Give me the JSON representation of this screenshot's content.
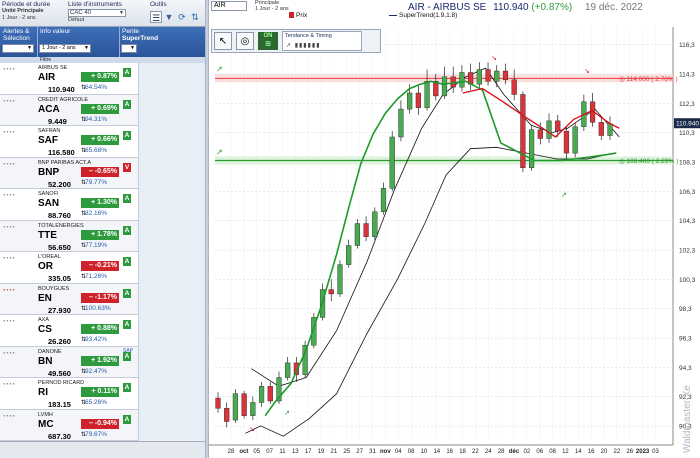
{
  "toolbar": {
    "period_label": "Période et durée",
    "period_sub1": "Unité Principale",
    "period_sub2": "1 Jour - 2 ans",
    "instr_label": "Liste d'instruments",
    "instr_value": "CAC 40",
    "instr_sub": "Défaut",
    "outils_label": "Outils"
  },
  "list_header": {
    "col1": "Alertes & Sélection",
    "col2": "Info valeur",
    "col2_dd": "1 Jour - 2 ans",
    "col3a": "Pente",
    "col3b": "SuperTrend",
    "filtre": "Filtre"
  },
  "rows": [
    {
      "name": "AIRBUS SE",
      "ticker": "AIR",
      "price": "110.940",
      "change": "+ 0.87%",
      "dir": "up",
      "pct2": "64.54%",
      "signal": "A",
      "sap": ""
    },
    {
      "name": "CREDIT AGRICOLE",
      "ticker": "ACA",
      "price": "9.449",
      "change": "+ 0.69%",
      "dir": "up",
      "pct2": "94.31%",
      "signal": "A",
      "sap": ""
    },
    {
      "name": "SAFRAN",
      "ticker": "SAF",
      "price": "116.580",
      "change": "+ 0.66%",
      "dir": "up",
      "pct2": "65.68%",
      "signal": "A",
      "sap": ""
    },
    {
      "name": "BNP PARIBAS ACT.A",
      "ticker": "BNP",
      "price": "52.200",
      "change": "– -0.65%",
      "dir": "dn",
      "pct2": "79.77%",
      "signal": "V",
      "sap": ""
    },
    {
      "name": "SANOFI",
      "ticker": "SAN",
      "price": "88.760",
      "change": "+ 1.30%",
      "dir": "up",
      "pct2": "82.16%",
      "signal": "A",
      "sap": ""
    },
    {
      "name": "TOTALENERGIES",
      "ticker": "TTE",
      "price": "56.650",
      "change": "+ 1.78%",
      "dir": "up",
      "pct2": "77.19%",
      "signal": "A",
      "sap": ""
    },
    {
      "name": "L'OREAL",
      "ticker": "OR",
      "price": "335.05",
      "change": "– -0.21%",
      "dir": "dn",
      "pct2": "71.26%",
      "signal": "A",
      "sap": ""
    },
    {
      "name": "BOUYGUES",
      "ticker": "EN",
      "price": "27.930",
      "change": "– -1.17%",
      "dir": "dn",
      "pct2": "100.63%",
      "signal": "A",
      "sap": ""
    },
    {
      "name": "AXA",
      "ticker": "CS",
      "price": "26.260",
      "change": "+ 0.88%",
      "dir": "up",
      "pct2": "93.42%",
      "signal": "A",
      "sap": ""
    },
    {
      "name": "DANONE",
      "ticker": "BN",
      "price": "49.560",
      "change": "+ 1.92%",
      "dir": "up",
      "pct2": "92.47%",
      "signal": "A",
      "sap": "SAP"
    },
    {
      "name": "PERNOD RICARD",
      "ticker": "RI",
      "price": "183.15",
      "change": "+ 0.11%",
      "dir": "up",
      "pct2": "65.26%",
      "signal": "A",
      "sap": ""
    },
    {
      "name": "LVMH",
      "ticker": "MC",
      "price": "687.30",
      "change": "– -0.94%",
      "dir": "dn",
      "pct2": "79.67%",
      "signal": "A",
      "sap": ""
    }
  ],
  "chart_header": {
    "symbol": "AIR",
    "princ_line1": "Principale",
    "princ_line2": "1 Jour - 2 ans",
    "legend_price": "Prix",
    "legend_st": "SuperTrend(1.9,1.8)",
    "title_name": "AIR - AIRBUS SE",
    "title_price": "110.940",
    "title_change": "(+0.87%)",
    "title_date": "19 déc. 2022",
    "tendance_label": "Tendance & Timing",
    "on_label": "ON"
  },
  "chart_data": {
    "type": "candlestick",
    "ylim": [
      89,
      117.5
    ],
    "yticks": [
      "116,3",
      "114,3",
      "112,3",
      "110,3",
      "108,3",
      "106,3",
      "104,3",
      "102,3",
      "100,3",
      "98,3",
      "96,3",
      "94,3",
      "92,3",
      "90,3"
    ],
    "xticks": [
      "28",
      "oct",
      "05",
      "07",
      "11",
      "13",
      "17",
      "19",
      "21",
      "25",
      "27",
      "31",
      "nov",
      "04",
      "08",
      "10",
      "14",
      "16",
      "18",
      "22",
      "24",
      "28",
      "déc",
      "02",
      "06",
      "08",
      "12",
      "14",
      "16",
      "20",
      "22",
      "26",
      "2023",
      "03"
    ],
    "last_price": "110.940",
    "resistance": {
      "value": 114.0,
      "label": "◎ 114.000 ( 2.76% )",
      "color": "#e83a3a"
    },
    "support": {
      "value": 108.4,
      "label": "◎ 108.400 ( 2.29% )",
      "color": "#2e9a2e"
    },
    "candles": [
      [
        92.2,
        91.5,
        92.6,
        91.2
      ],
      [
        91.5,
        90.6,
        91.9,
        90.2
      ],
      [
        90.7,
        92.5,
        92.8,
        90.5
      ],
      [
        92.5,
        91.0,
        92.7,
        90.8
      ],
      [
        91.0,
        91.9,
        92.3,
        90.7
      ],
      [
        91.9,
        93.0,
        93.3,
        91.6
      ],
      [
        93.0,
        92.0,
        93.3,
        91.8
      ],
      [
        92.0,
        93.6,
        94.0,
        91.8
      ],
      [
        93.6,
        94.6,
        95.0,
        93.4
      ],
      [
        94.6,
        93.8,
        95.0,
        93.3
      ],
      [
        93.8,
        95.8,
        96.1,
        93.6
      ],
      [
        95.8,
        97.7,
        98.0,
        95.6
      ],
      [
        97.7,
        99.6,
        100.0,
        97.5
      ],
      [
        99.6,
        99.3,
        100.3,
        98.8
      ],
      [
        99.3,
        101.3,
        101.6,
        99.1
      ],
      [
        101.3,
        102.6,
        103.0,
        101.1
      ],
      [
        102.6,
        104.1,
        104.4,
        102.4
      ],
      [
        104.1,
        103.2,
        104.6,
        102.9
      ],
      [
        103.2,
        104.9,
        105.2,
        103.0
      ],
      [
        104.9,
        106.5,
        106.9,
        104.7
      ],
      [
        106.5,
        110.0,
        110.4,
        106.3
      ],
      [
        110.0,
        111.9,
        112.5,
        109.7
      ],
      [
        111.9,
        113.0,
        113.6,
        111.6
      ],
      [
        113.0,
        112.0,
        113.6,
        111.5
      ],
      [
        112.0,
        113.8,
        114.6,
        111.8
      ],
      [
        113.8,
        112.8,
        114.3,
        112.5
      ],
      [
        112.8,
        114.1,
        114.8,
        112.6
      ],
      [
        114.1,
        113.4,
        114.8,
        113.0
      ],
      [
        113.4,
        114.4,
        114.9,
        113.1
      ],
      [
        114.4,
        113.6,
        115.0,
        113.2
      ],
      [
        113.6,
        114.6,
        115.1,
        113.3
      ],
      [
        114.6,
        113.8,
        115.1,
        113.5
      ],
      [
        113.8,
        114.5,
        114.9,
        113.4
      ],
      [
        114.5,
        113.9,
        115.0,
        113.6
      ],
      [
        113.9,
        112.9,
        114.6,
        112.5
      ],
      [
        112.9,
        107.9,
        113.1,
        107.6
      ],
      [
        107.9,
        110.5,
        110.8,
        107.7
      ],
      [
        110.5,
        109.9,
        111.0,
        109.5
      ],
      [
        109.9,
        111.1,
        111.6,
        109.6
      ],
      [
        111.1,
        110.4,
        111.5,
        110.0
      ],
      [
        110.4,
        108.9,
        110.7,
        108.5
      ],
      [
        108.9,
        110.7,
        111.0,
        108.6
      ],
      [
        110.7,
        112.4,
        112.9,
        110.4
      ],
      [
        112.4,
        111.0,
        113.0,
        110.7
      ],
      [
        111.0,
        110.1,
        111.4,
        109.8
      ],
      [
        110.1,
        110.9,
        111.4,
        109.8
      ]
    ],
    "supertrend_green": [
      [
        33,
        91.0
      ],
      [
        40,
        92.0
      ],
      [
        50,
        93.2
      ],
      [
        60,
        95.5
      ],
      [
        70,
        98.5
      ],
      [
        80,
        102.0
      ],
      [
        88,
        105.2
      ],
      [
        96,
        108.2
      ],
      [
        104,
        110.2
      ],
      [
        112,
        111.6
      ],
      [
        120,
        112.6
      ],
      [
        128,
        113.3
      ],
      [
        135,
        113.6
      ],
      [
        142,
        113.8
      ],
      [
        150,
        113.6
      ],
      [
        165,
        113.8
      ],
      [
        176,
        113.2
      ],
      [
        188,
        109.6
      ],
      [
        210,
        108.4
      ],
      [
        228,
        108.4
      ],
      [
        244,
        108.6
      ],
      [
        258,
        108.8
      ],
      [
        264,
        108.9
      ]
    ],
    "supertrend_red": [
      [
        163,
        113.0
      ],
      [
        176,
        113.3
      ],
      [
        188,
        112.5
      ],
      [
        205,
        111.3
      ],
      [
        214,
        110.7
      ],
      [
        224,
        110.0
      ],
      [
        236,
        111.2
      ],
      [
        248,
        111.8
      ],
      [
        260,
        110.9
      ],
      [
        266,
        110.6
      ]
    ],
    "black_upper": [
      [
        24,
        94.2
      ],
      [
        42,
        93.0
      ],
      [
        60,
        93.6
      ],
      [
        80,
        96.8
      ],
      [
        100,
        101.5
      ],
      [
        118,
        106.4
      ],
      [
        136,
        110.6
      ],
      [
        150,
        112.9
      ],
      [
        165,
        114.1
      ],
      [
        178,
        114.7
      ],
      [
        190,
        112.9
      ],
      [
        208,
        110.8
      ],
      [
        222,
        110.3
      ],
      [
        232,
        110.6
      ],
      [
        250,
        111.9
      ],
      [
        266,
        110.0
      ]
    ],
    "black_lower": [
      [
        20,
        89.8
      ],
      [
        30,
        90.3
      ],
      [
        45,
        89.6
      ],
      [
        62,
        90.8
      ],
      [
        80,
        92.5
      ],
      [
        100,
        96.6
      ],
      [
        120,
        100.3
      ],
      [
        138,
        104.1
      ],
      [
        152,
        107.4
      ],
      [
        168,
        109.2
      ],
      [
        185,
        109.3
      ],
      [
        205,
        108.9
      ],
      [
        225,
        108.5
      ],
      [
        245,
        108.5
      ],
      [
        262,
        108.9
      ]
    ]
  }
}
